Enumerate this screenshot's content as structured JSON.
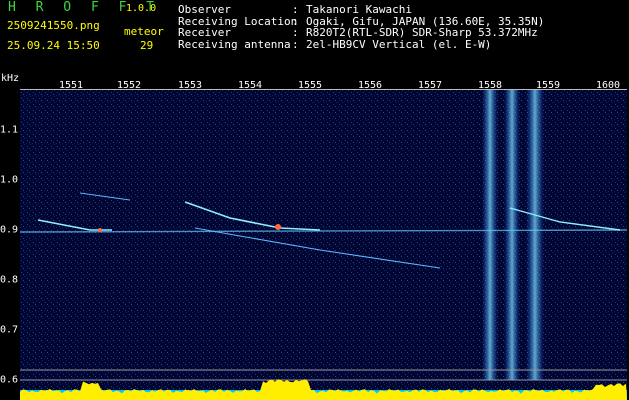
{
  "header": {
    "brand": "H R O F F T",
    "version": "1.0.0",
    "filename": "2509241550.png",
    "meteor_label": "meteor",
    "timestamp": "25.09.24 15:50",
    "meteor_count": "29"
  },
  "info": [
    {
      "key": "Observer",
      "value": "Takanori Kawachi"
    },
    {
      "key": "Receiving Location",
      "value": "Ogaki, Gifu, JAPAN (136.60E, 35.35N)"
    },
    {
      "key": "Receiver",
      "value": "R820T2(RTL-SDR) SDR-Sharp 53.372MHz"
    },
    {
      "key": "Receiving antenna",
      "value": "2el-HB9CV Vertical (el. E-W)"
    }
  ],
  "axis": {
    "y_unit": "kHz",
    "x_ticks": [
      "1551",
      "1552",
      "1553",
      "1554",
      "1555",
      "1556",
      "1557",
      "1558",
      "1559",
      "1600"
    ],
    "y_ticks": [
      "1.1",
      "1.0",
      "0.9",
      "0.8",
      "0.7",
      "0.6"
    ]
  },
  "colors": {
    "brand": "#3fd43f",
    "meta": "#ffff00",
    "background": "#00042a",
    "carrier": "#66ccff",
    "level_fill": "#ffee00",
    "level_base": "#00c8ff"
  }
}
